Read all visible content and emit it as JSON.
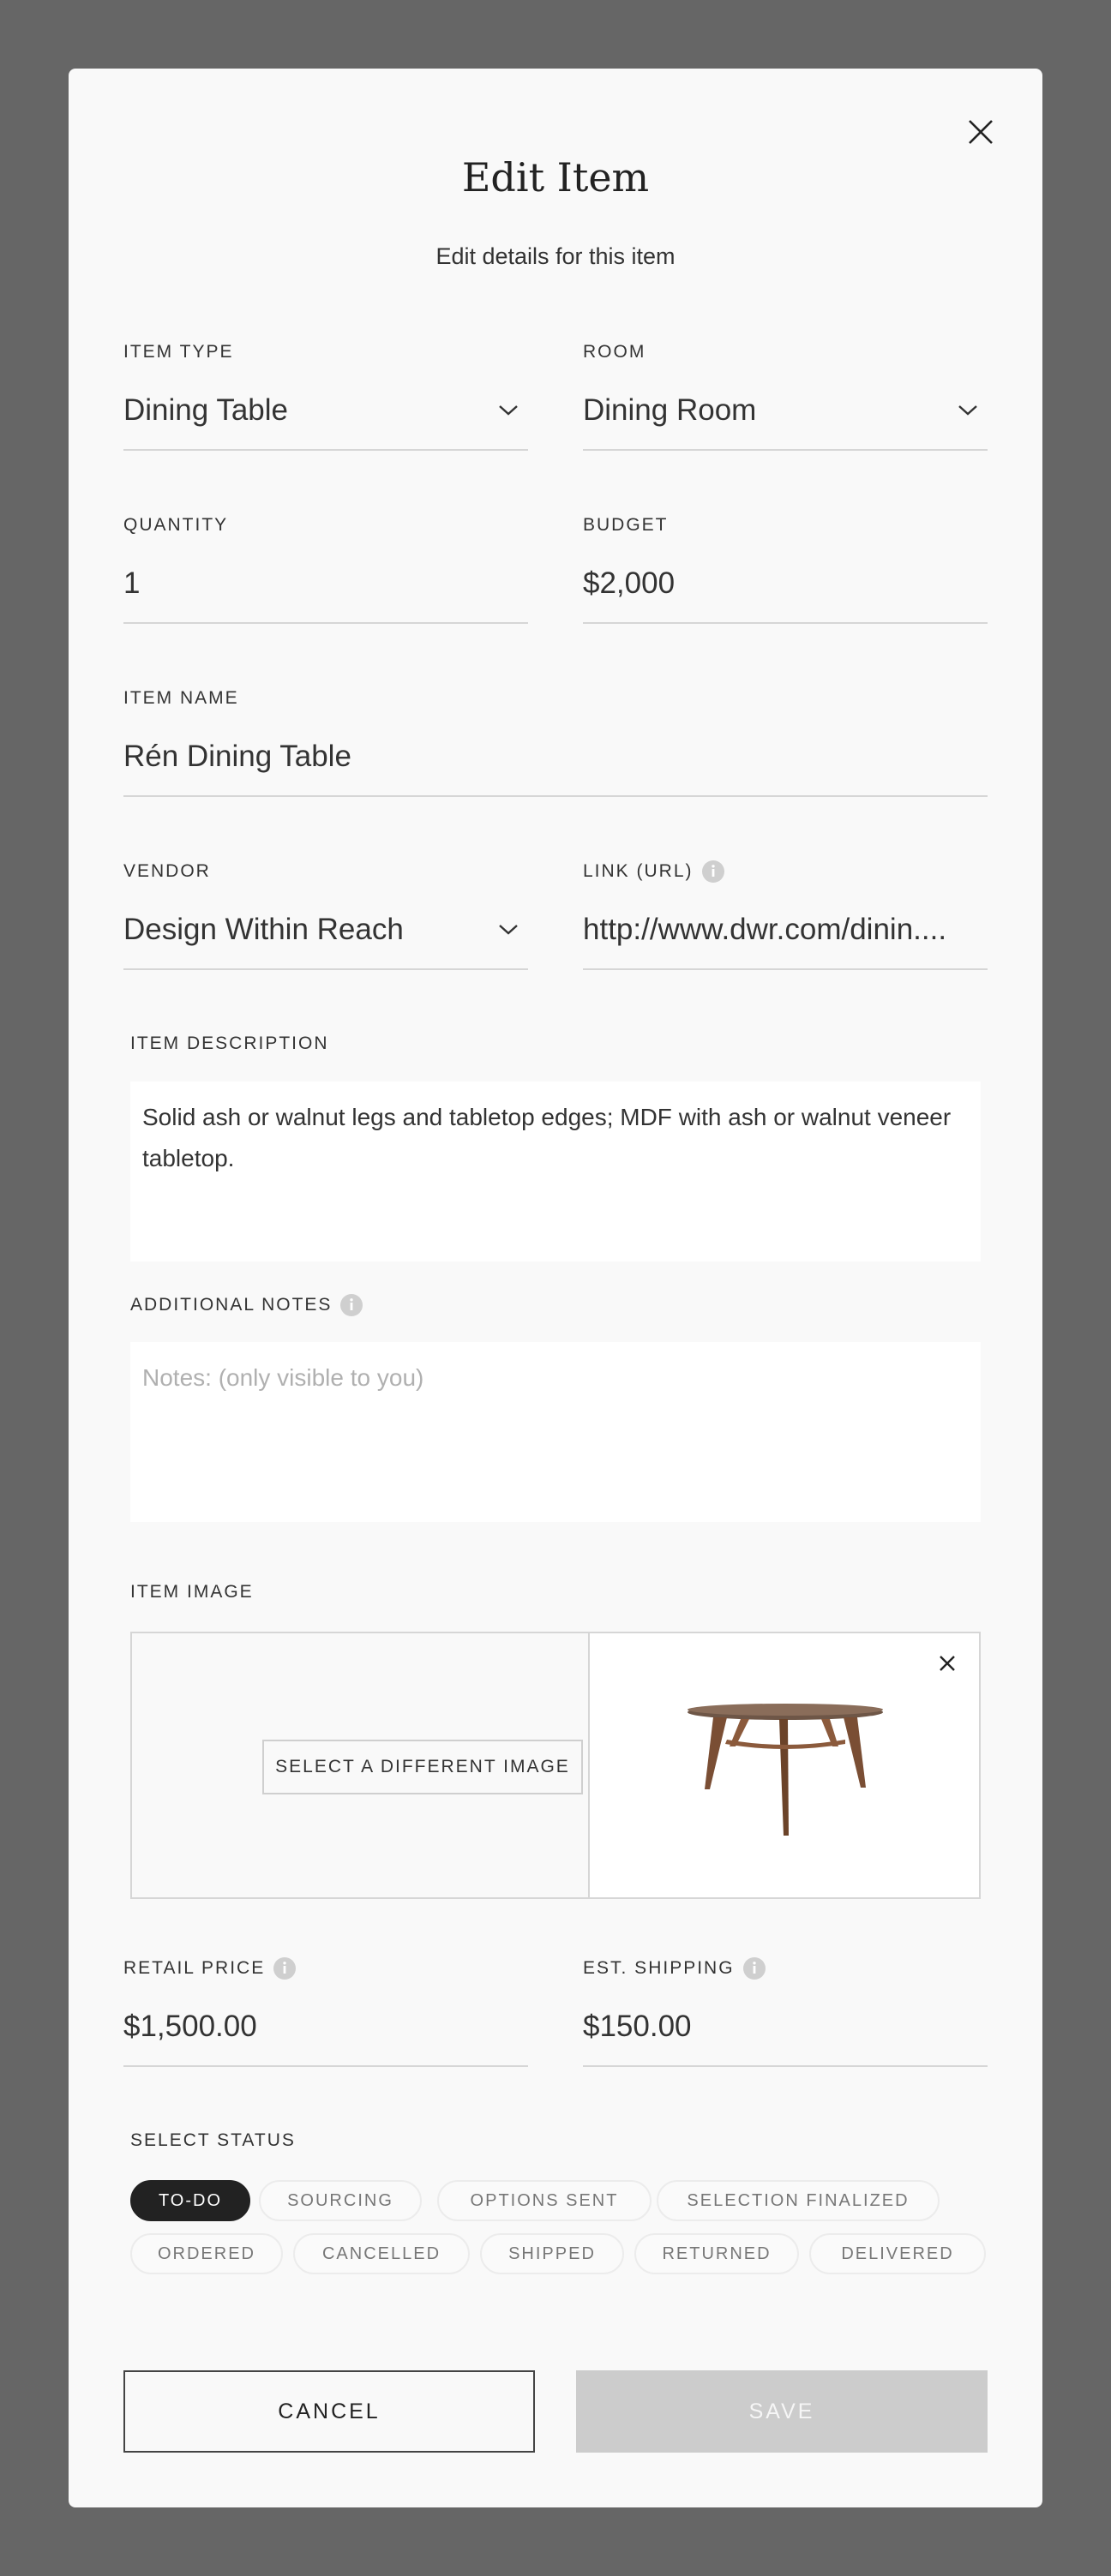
{
  "modal": {
    "title": "Edit Item",
    "subtitle": "Edit details for this item"
  },
  "fields": {
    "item_type": {
      "label": "ITEM TYPE",
      "value": "Dining Table"
    },
    "room": {
      "label": "ROOM",
      "value": "Dining Room"
    },
    "quantity": {
      "label": "QUANTITY",
      "value": "1"
    },
    "budget": {
      "label": "BUDGET",
      "value": "$2,000"
    },
    "item_name": {
      "label": "ITEM NAME",
      "value": "Rén Dining Table"
    },
    "vendor": {
      "label": "VENDOR",
      "value": "Design Within Reach"
    },
    "link": {
      "label": "LINK (URL)",
      "value": "http://www.dwr.com/dinin...."
    },
    "description": {
      "label": "ITEM DESCRIPTION",
      "value": "Solid ash or walnut legs and tabletop edges; MDF with ash or walnut veneer tabletop."
    },
    "notes": {
      "label": "ADDITIONAL NOTES",
      "value": "",
      "placeholder": "Notes:  (only visible to you)"
    },
    "retail_price": {
      "label": "RETAIL PRICE",
      "value": "$1,500.00"
    },
    "est_shipping": {
      "label": "EST. SHIPPING",
      "value": "$150.00"
    }
  },
  "image": {
    "label": "ITEM IMAGE",
    "select_button": "SELECT A DIFFERENT IMAGE"
  },
  "status": {
    "label": "SELECT STATUS",
    "options": [
      "TO-DO",
      "SOURCING",
      "OPTIONS SENT",
      "SELECTION FINALIZED",
      "ORDERED",
      "CANCELLED",
      "SHIPPED",
      "RETURNED",
      "DELIVERED"
    ],
    "selected": "TO-DO"
  },
  "actions": {
    "cancel_label": "CANCEL",
    "save_label": "SAVE"
  },
  "icons": {
    "close": "close-icon",
    "chevron": "chevron-down-icon",
    "info": "info-icon",
    "remove_image": "remove-image-icon"
  },
  "colors": {
    "backdrop": "#666666",
    "modal_bg": "#f9f9f9",
    "active_pill": "#222222",
    "save_disabled": "#cccccc"
  }
}
